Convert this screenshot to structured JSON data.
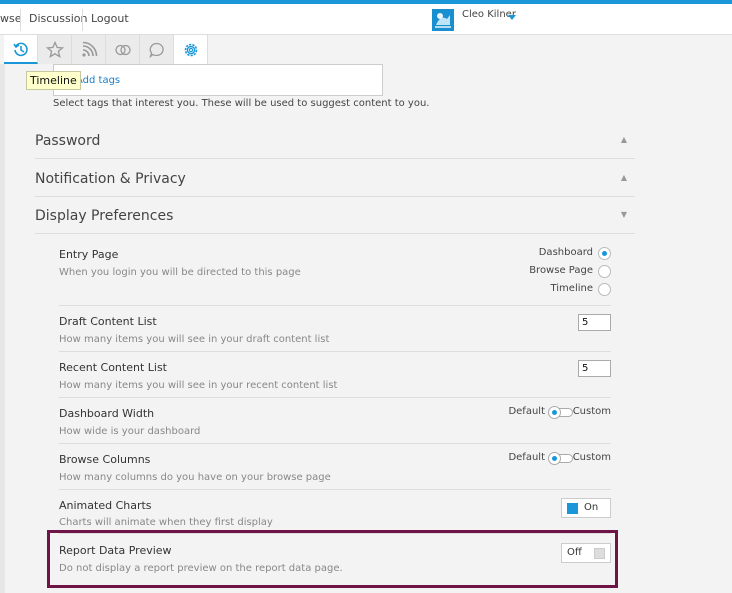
{
  "topnav": {
    "items": [
      "wse",
      "Discussion",
      "Logout"
    ],
    "user_name": "Cleo Kilner"
  },
  "icon_tabs": [
    "history-icon",
    "star-icon",
    "rss-icon",
    "circles-icon",
    "chat-icon",
    "gear-icon"
  ],
  "tooltip": "Timeline",
  "tags": {
    "link": "Add tags",
    "hint": "Select tags that interest you. These will be used to suggest content to you."
  },
  "sections": {
    "password": "Password",
    "notification": "Notification & Privacy",
    "display": "Display Preferences"
  },
  "prefs": {
    "entry_page": {
      "title": "Entry Page",
      "desc": "When you login you will be directed to this page",
      "options": [
        "Dashboard",
        "Browse Page",
        "Timeline"
      ],
      "selected": "Dashboard"
    },
    "draft_list": {
      "title": "Draft Content List",
      "desc": "How many items you will see in your draft content list",
      "value": "5"
    },
    "recent_list": {
      "title": "Recent Content List",
      "desc": "How many items you will see in your recent content list",
      "value": "5"
    },
    "dash_width": {
      "title": "Dashboard Width",
      "desc": "How wide is your dashboard",
      "left": "Default",
      "right": "Custom"
    },
    "browse_cols": {
      "title": "Browse Columns",
      "desc": "How many columns do you have on your browse page",
      "left": "Default",
      "right": "Custom"
    },
    "anim_charts": {
      "title": "Animated Charts",
      "desc": "Charts will animate when they first display",
      "state": "On"
    },
    "report_preview": {
      "title": "Report Data Preview",
      "desc": "Do not display a report preview on the report data page.",
      "state": "Off"
    }
  },
  "colors": {
    "accent": "#1a97d8",
    "highlight": "#6e1446"
  }
}
